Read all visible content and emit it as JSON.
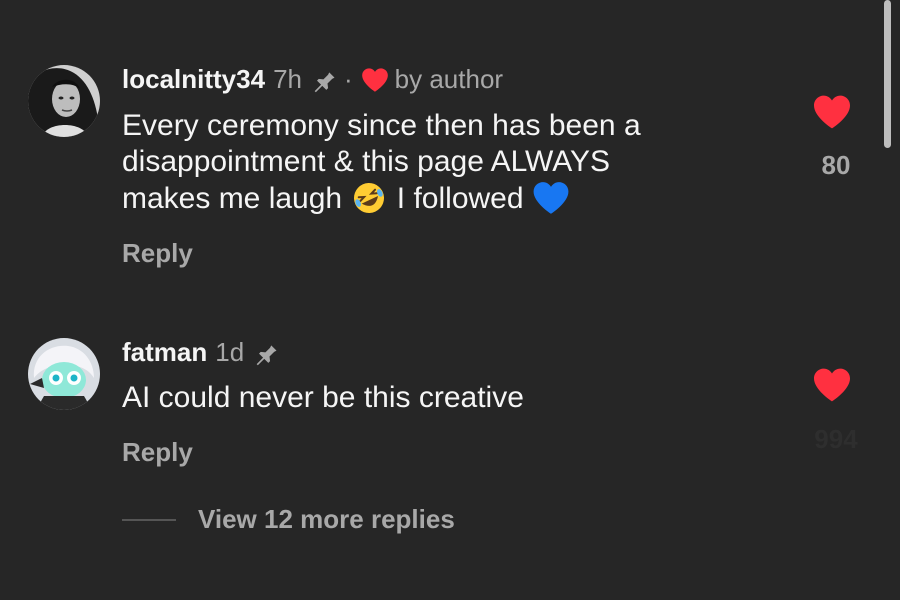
{
  "comments": [
    {
      "username": "localnitty34",
      "time": "7h",
      "separator": "·",
      "author_tag": "by author",
      "text_line1": "Every ceremony since then has been a",
      "text_line2": "disappointment & this page ALWAYS",
      "text_line3_a": "makes me laugh",
      "text_line3_b": "I followed",
      "emoji_1": "rolling-on-floor-laughing-emoji",
      "emoji_2": "blue-heart-emoji",
      "reply_label": "Reply",
      "like_count": "80",
      "liked": true
    },
    {
      "username": "fatman",
      "time": "1d",
      "text": "AI could never be this creative",
      "reply_label": "Reply",
      "like_count": "994",
      "liked": true
    }
  ],
  "view_replies_label": "View 12 more replies",
  "colors": {
    "background": "#262626",
    "primary_text": "#f5f5f5",
    "secondary_text": "#a8a8a8",
    "like_red": "#ff3040",
    "blue_heart": "#1877f2"
  }
}
